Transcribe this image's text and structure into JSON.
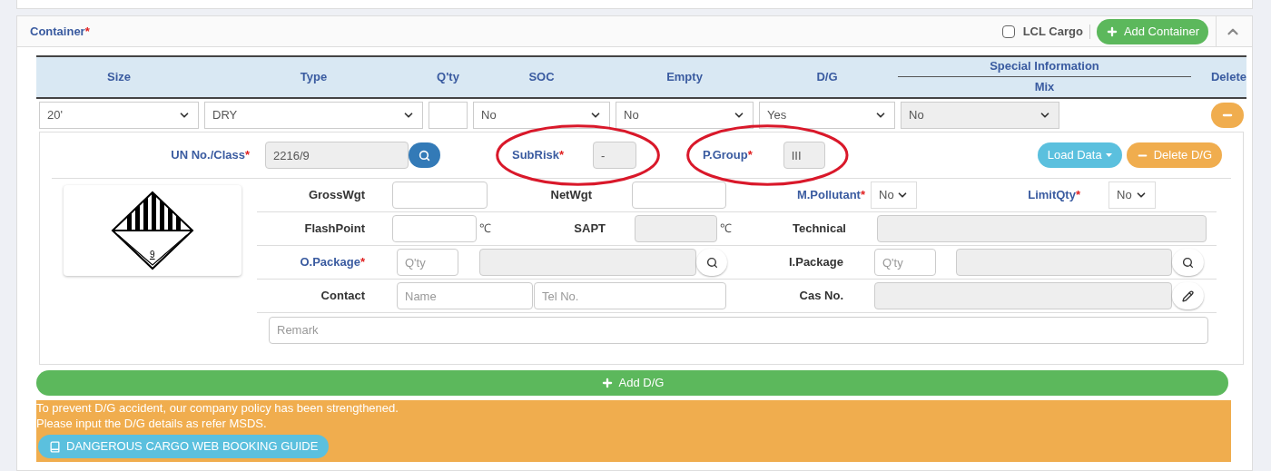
{
  "panel": {
    "title": "Container",
    "required_mark": "*",
    "lcl_cargo": {
      "label": "LCL Cargo",
      "checked": false
    },
    "add_button": "Add Container"
  },
  "table": {
    "columns": [
      "Size",
      "Type",
      "Q'ty",
      "SOC",
      "Empty",
      "D/G"
    ],
    "group_header": "Special Information",
    "group_columns": [
      "Mix"
    ],
    "delete_column": "Delete"
  },
  "rows": [
    {
      "cells": [
        {
          "kind": "select",
          "value": "20'",
          "disabled": false
        },
        {
          "kind": "select",
          "value": "DRY",
          "disabled": false
        },
        {
          "kind": "input",
          "disabled": false
        },
        {
          "kind": "select",
          "value": "No",
          "disabled": false
        },
        {
          "kind": "select",
          "value": "No",
          "disabled": false
        },
        {
          "kind": "select",
          "value": "Yes",
          "disabled": false
        },
        {
          "kind": "select",
          "value": "No",
          "disabled": true
        }
      ]
    }
  ],
  "dg": {
    "top_fields": [
      {
        "label": "UN No./Class",
        "required_mark": "*",
        "value": "2216/9",
        "circled": false
      },
      {
        "label": "SubRisk",
        "required_mark": "*",
        "value": "-",
        "circled": true
      },
      {
        "label": "P.Group",
        "required_mark": "*",
        "value": "III",
        "circled": true
      }
    ],
    "load_button": "Load Data",
    "delete_button": "Delete D/G",
    "placard_number": "9",
    "field_rows": [
      [
        {
          "kind": "label",
          "text": "GrossWgt"
        },
        {
          "kind": "input",
          "disabled": false
        },
        {
          "kind": "label",
          "text": "NetWgt"
        },
        {
          "kind": "input",
          "disabled": false
        },
        {
          "kind": "label",
          "text": "M.Pollutant",
          "required_mark": "*"
        },
        {
          "kind": "select",
          "value": "No"
        },
        {
          "kind": "label",
          "text": "LimitQty",
          "required_mark": "*"
        },
        {
          "kind": "select",
          "value": "No"
        }
      ],
      [
        {
          "kind": "label",
          "text": "FlashPoint"
        },
        {
          "kind": "input",
          "disabled": false
        },
        {
          "kind": "unit",
          "text": "℃"
        },
        {
          "kind": "label",
          "text": "SAPT"
        },
        {
          "kind": "input",
          "disabled": true
        },
        {
          "kind": "unit",
          "text": "℃"
        },
        {
          "kind": "label",
          "text": "Technical"
        },
        {
          "kind": "input",
          "disabled": true
        }
      ],
      [
        {
          "kind": "label",
          "text": "O.Package",
          "required_mark": "*"
        },
        {
          "kind": "input",
          "placeholder": "Q'ty",
          "disabled": false
        },
        {
          "kind": "input",
          "disabled": true
        },
        {
          "kind": "search"
        },
        {
          "kind": "label",
          "text": "I.Package"
        },
        {
          "kind": "input",
          "placeholder": "Q'ty",
          "disabled": false
        },
        {
          "kind": "input",
          "disabled": true
        },
        {
          "kind": "search"
        }
      ],
      [
        {
          "kind": "label",
          "text": "Contact"
        },
        {
          "kind": "input",
          "placeholder": "Name",
          "disabled": false
        },
        {
          "kind": "input",
          "placeholder": "Tel No.",
          "disabled": false
        },
        {
          "kind": "label",
          "text": "Cas No."
        },
        {
          "kind": "input",
          "disabled": true
        },
        {
          "kind": "edit"
        }
      ],
      [
        {
          "kind": "input",
          "placeholder": "Remark",
          "disabled": false
        }
      ]
    ]
  },
  "add_dg_button": "Add D/G",
  "notice": {
    "lines": [
      "To prevent D/G accident, our company policy has been strengthened.",
      "Please input the D/G details as refer MSDS."
    ],
    "guide_button": "DANGEROUS CARGO WEB BOOKING GUIDE"
  }
}
